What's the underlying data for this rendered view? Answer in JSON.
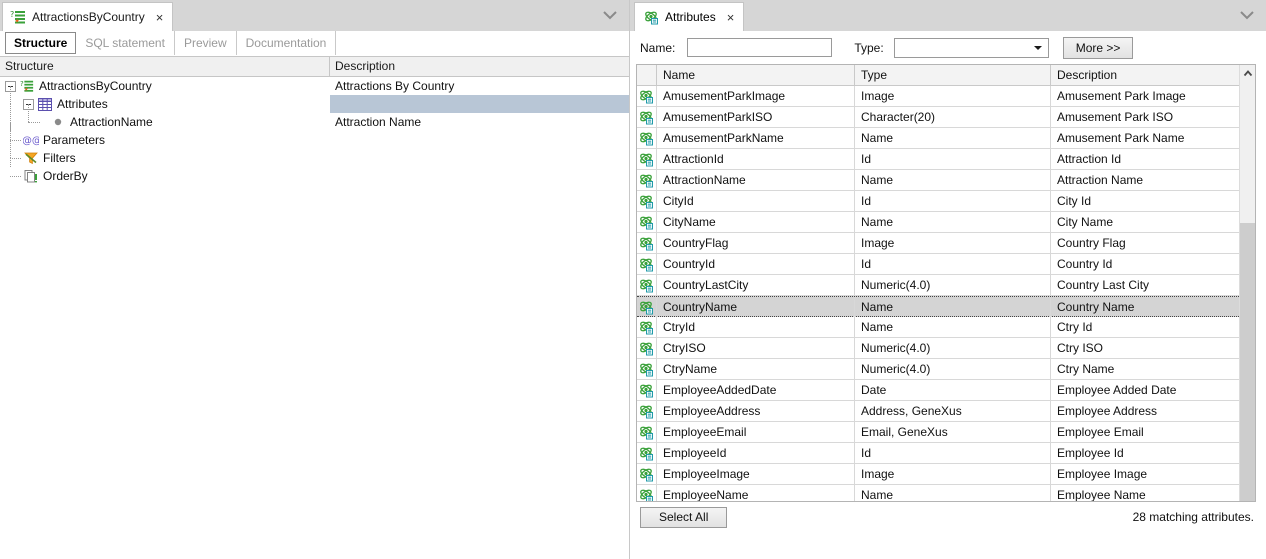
{
  "left_panel": {
    "document_tab": {
      "label": "AttractionsByCountry",
      "icon": "data-selector-icon",
      "close": "×"
    },
    "collapse_icon": "chevron-down-icon",
    "subtabs": [
      {
        "label": "Structure",
        "active": true
      },
      {
        "label": "SQL statement",
        "active": false
      },
      {
        "label": "Preview",
        "active": false
      },
      {
        "label": "Documentation",
        "active": false
      }
    ],
    "columns": {
      "structure": "Structure",
      "description": "Description"
    },
    "tree": [
      {
        "label": "AttractionsByCountry",
        "description": "Attractions By Country",
        "icon": "data-selector-icon",
        "level": 0,
        "expander": "minus",
        "selected": false
      },
      {
        "label": "Attributes",
        "description": "",
        "icon": "grid-table-icon",
        "level": 1,
        "expander": "minus",
        "selected": true
      },
      {
        "label": "AttractionName",
        "description": "Attraction Name",
        "icon": "bullet-icon",
        "level": 2,
        "expander": "none",
        "selected": false
      },
      {
        "label": "Parameters",
        "description": "",
        "icon": "at-at-icon",
        "level": 1,
        "expander": "none",
        "selected": false
      },
      {
        "label": "Filters",
        "description": "",
        "icon": "funnel-icon",
        "level": 1,
        "expander": "none",
        "selected": false
      },
      {
        "label": "OrderBy",
        "description": "",
        "icon": "order-by-icon",
        "level": 1,
        "expander": "none",
        "selected": false
      }
    ]
  },
  "right_panel": {
    "tab": {
      "label": "Attributes",
      "icon": "attribute-atom-icon",
      "close": "×"
    },
    "collapse_icon": "chevron-down-icon",
    "search": {
      "name_label": "Name:",
      "name_value": "",
      "name_placeholder": "",
      "type_label": "Type:",
      "type_value": "",
      "more_button": "More >>"
    },
    "grid": {
      "columns": [
        "",
        "Name",
        "Type",
        "Description"
      ],
      "rows": [
        {
          "icon": "attribute-atom-icon",
          "name": "AmusementParkImage",
          "type": "Image",
          "description": "Amusement Park Image",
          "selected": false
        },
        {
          "icon": "attribute-atom-icon",
          "name": "AmusementParkISO",
          "type": "Character(20)",
          "description": "Amusement Park ISO",
          "selected": false
        },
        {
          "icon": "attribute-atom-icon",
          "name": "AmusementParkName",
          "type": "Name",
          "description": "Amusement Park Name",
          "selected": false
        },
        {
          "icon": "attribute-atom-icon",
          "name": "AttractionId",
          "type": "Id",
          "description": "Attraction Id",
          "selected": false
        },
        {
          "icon": "attribute-atom-icon",
          "name": "AttractionName",
          "type": "Name",
          "description": "Attraction Name",
          "selected": false
        },
        {
          "icon": "attribute-atom-icon",
          "name": "CityId",
          "type": "Id",
          "description": "City Id",
          "selected": false
        },
        {
          "icon": "attribute-atom-icon",
          "name": "CityName",
          "type": "Name",
          "description": "City Name",
          "selected": false
        },
        {
          "icon": "attribute-atom-icon",
          "name": "CountryFlag",
          "type": "Image",
          "description": "Country Flag",
          "selected": false
        },
        {
          "icon": "attribute-atom-icon",
          "name": "CountryId",
          "type": "Id",
          "description": "Country Id",
          "selected": false
        },
        {
          "icon": "attribute-atom-icon",
          "name": "CountryLastCity",
          "type": "Numeric(4.0)",
          "description": "Country Last City",
          "selected": false
        },
        {
          "icon": "attribute-atom-icon",
          "name": "CountryName",
          "type": "Name",
          "description": "Country Name",
          "selected": true
        },
        {
          "icon": "attribute-atom-icon",
          "name": "CtryId",
          "type": "Name",
          "description": "Ctry Id",
          "selected": false
        },
        {
          "icon": "attribute-atom-icon",
          "name": "CtryISO",
          "type": "Numeric(4.0)",
          "description": "Ctry ISO",
          "selected": false
        },
        {
          "icon": "attribute-atom-icon",
          "name": "CtryName",
          "type": "Numeric(4.0)",
          "description": "Ctry Name",
          "selected": false
        },
        {
          "icon": "attribute-atom-icon",
          "name": "EmployeeAddedDate",
          "type": "Date",
          "description": "Employee Added Date",
          "selected": false
        },
        {
          "icon": "attribute-atom-icon",
          "name": "EmployeeAddress",
          "type": "Address, GeneXus",
          "description": "Employee Address",
          "selected": false
        },
        {
          "icon": "attribute-atom-icon",
          "name": "EmployeeEmail",
          "type": "Email, GeneXus",
          "description": "Employee Email",
          "selected": false
        },
        {
          "icon": "attribute-atom-icon",
          "name": "EmployeeId",
          "type": "Id",
          "description": "Employee Id",
          "selected": false
        },
        {
          "icon": "attribute-atom-icon",
          "name": "EmployeeImage",
          "type": "Image",
          "description": "Employee Image",
          "selected": false
        },
        {
          "icon": "attribute-atom-icon",
          "name": "EmployeeName",
          "type": "Name",
          "description": "Employee Name",
          "selected": false
        }
      ]
    },
    "footer": {
      "select_all_button": "Select All",
      "status": "28 matching attributes."
    }
  },
  "colors": {
    "tabstrip_bg": "#d6d6d6",
    "selection_blue": "#b8c6d6",
    "grid_selection": "#d4d4d4",
    "icon_green": "#3aa13a",
    "icon_teal": "#17a2b8",
    "icon_purple": "#6a5acd",
    "icon_orange": "#e8881a"
  }
}
